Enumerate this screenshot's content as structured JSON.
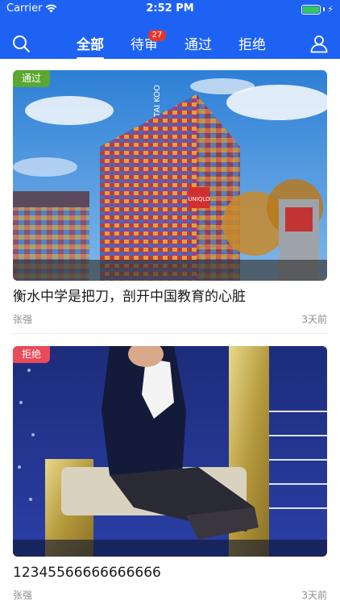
{
  "status_bar": {
    "carrier": "Carrier",
    "time": "2:52 PM",
    "battery_percent": 100,
    "battery_color": "#34c759"
  },
  "nav": {
    "background_color": "#1e62f4",
    "left_icon": "search-icon",
    "right_icon": "user-profile-icon",
    "tabs": [
      {
        "label": "全部",
        "active": true
      },
      {
        "label": "待审",
        "badge": "27"
      },
      {
        "label": "通过"
      },
      {
        "label": "拒绝"
      }
    ]
  },
  "feed": {
    "items": [
      {
        "status": "通过",
        "status_color": "#5ba732",
        "title": "衡水中学是把刀，剖开中国教育的心脏",
        "author": "张强",
        "time_ago": "3天前",
        "image_subject": "colorful-glass-building-photo",
        "image_text": {
          "sign_1": "TAI KOO",
          "sign_2": "UNIQLO"
        }
      },
      {
        "status": "拒绝",
        "status_color": "#ea4a5a",
        "title": "12345566666666666",
        "author": "张强",
        "time_ago": "3天前",
        "image_subject": "woman-on-throne-photo"
      }
    ]
  }
}
